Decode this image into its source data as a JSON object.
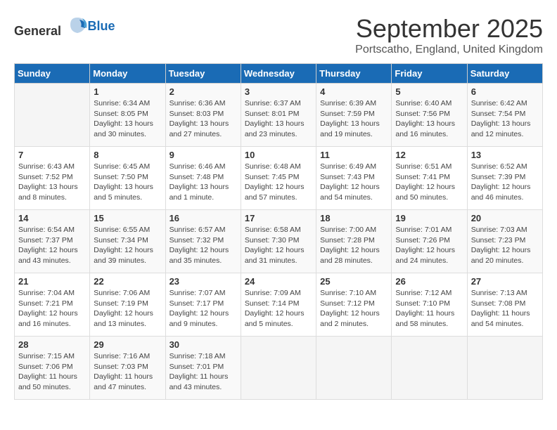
{
  "header": {
    "logo_general": "General",
    "logo_blue": "Blue",
    "month_title": "September 2025",
    "location": "Portscatho, England, United Kingdom"
  },
  "days_of_week": [
    "Sunday",
    "Monday",
    "Tuesday",
    "Wednesday",
    "Thursday",
    "Friday",
    "Saturday"
  ],
  "weeks": [
    [
      {
        "day": "",
        "content": ""
      },
      {
        "day": "1",
        "content": "Sunrise: 6:34 AM\nSunset: 8:05 PM\nDaylight: 13 hours\nand 30 minutes."
      },
      {
        "day": "2",
        "content": "Sunrise: 6:36 AM\nSunset: 8:03 PM\nDaylight: 13 hours\nand 27 minutes."
      },
      {
        "day": "3",
        "content": "Sunrise: 6:37 AM\nSunset: 8:01 PM\nDaylight: 13 hours\nand 23 minutes."
      },
      {
        "day": "4",
        "content": "Sunrise: 6:39 AM\nSunset: 7:59 PM\nDaylight: 13 hours\nand 19 minutes."
      },
      {
        "day": "5",
        "content": "Sunrise: 6:40 AM\nSunset: 7:56 PM\nDaylight: 13 hours\nand 16 minutes."
      },
      {
        "day": "6",
        "content": "Sunrise: 6:42 AM\nSunset: 7:54 PM\nDaylight: 13 hours\nand 12 minutes."
      }
    ],
    [
      {
        "day": "7",
        "content": "Sunrise: 6:43 AM\nSunset: 7:52 PM\nDaylight: 13 hours\nand 8 minutes."
      },
      {
        "day": "8",
        "content": "Sunrise: 6:45 AM\nSunset: 7:50 PM\nDaylight: 13 hours\nand 5 minutes."
      },
      {
        "day": "9",
        "content": "Sunrise: 6:46 AM\nSunset: 7:48 PM\nDaylight: 13 hours\nand 1 minute."
      },
      {
        "day": "10",
        "content": "Sunrise: 6:48 AM\nSunset: 7:45 PM\nDaylight: 12 hours\nand 57 minutes."
      },
      {
        "day": "11",
        "content": "Sunrise: 6:49 AM\nSunset: 7:43 PM\nDaylight: 12 hours\nand 54 minutes."
      },
      {
        "day": "12",
        "content": "Sunrise: 6:51 AM\nSunset: 7:41 PM\nDaylight: 12 hours\nand 50 minutes."
      },
      {
        "day": "13",
        "content": "Sunrise: 6:52 AM\nSunset: 7:39 PM\nDaylight: 12 hours\nand 46 minutes."
      }
    ],
    [
      {
        "day": "14",
        "content": "Sunrise: 6:54 AM\nSunset: 7:37 PM\nDaylight: 12 hours\nand 43 minutes."
      },
      {
        "day": "15",
        "content": "Sunrise: 6:55 AM\nSunset: 7:34 PM\nDaylight: 12 hours\nand 39 minutes."
      },
      {
        "day": "16",
        "content": "Sunrise: 6:57 AM\nSunset: 7:32 PM\nDaylight: 12 hours\nand 35 minutes."
      },
      {
        "day": "17",
        "content": "Sunrise: 6:58 AM\nSunset: 7:30 PM\nDaylight: 12 hours\nand 31 minutes."
      },
      {
        "day": "18",
        "content": "Sunrise: 7:00 AM\nSunset: 7:28 PM\nDaylight: 12 hours\nand 28 minutes."
      },
      {
        "day": "19",
        "content": "Sunrise: 7:01 AM\nSunset: 7:26 PM\nDaylight: 12 hours\nand 24 minutes."
      },
      {
        "day": "20",
        "content": "Sunrise: 7:03 AM\nSunset: 7:23 PM\nDaylight: 12 hours\nand 20 minutes."
      }
    ],
    [
      {
        "day": "21",
        "content": "Sunrise: 7:04 AM\nSunset: 7:21 PM\nDaylight: 12 hours\nand 16 minutes."
      },
      {
        "day": "22",
        "content": "Sunrise: 7:06 AM\nSunset: 7:19 PM\nDaylight: 12 hours\nand 13 minutes."
      },
      {
        "day": "23",
        "content": "Sunrise: 7:07 AM\nSunset: 7:17 PM\nDaylight: 12 hours\nand 9 minutes."
      },
      {
        "day": "24",
        "content": "Sunrise: 7:09 AM\nSunset: 7:14 PM\nDaylight: 12 hours\nand 5 minutes."
      },
      {
        "day": "25",
        "content": "Sunrise: 7:10 AM\nSunset: 7:12 PM\nDaylight: 12 hours\nand 2 minutes."
      },
      {
        "day": "26",
        "content": "Sunrise: 7:12 AM\nSunset: 7:10 PM\nDaylight: 11 hours\nand 58 minutes."
      },
      {
        "day": "27",
        "content": "Sunrise: 7:13 AM\nSunset: 7:08 PM\nDaylight: 11 hours\nand 54 minutes."
      }
    ],
    [
      {
        "day": "28",
        "content": "Sunrise: 7:15 AM\nSunset: 7:06 PM\nDaylight: 11 hours\nand 50 minutes."
      },
      {
        "day": "29",
        "content": "Sunrise: 7:16 AM\nSunset: 7:03 PM\nDaylight: 11 hours\nand 47 minutes."
      },
      {
        "day": "30",
        "content": "Sunrise: 7:18 AM\nSunset: 7:01 PM\nDaylight: 11 hours\nand 43 minutes."
      },
      {
        "day": "",
        "content": ""
      },
      {
        "day": "",
        "content": ""
      },
      {
        "day": "",
        "content": ""
      },
      {
        "day": "",
        "content": ""
      }
    ]
  ]
}
